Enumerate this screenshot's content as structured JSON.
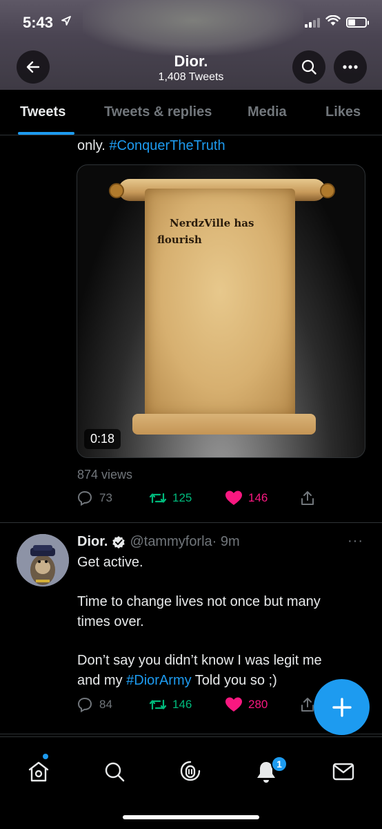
{
  "status_bar": {
    "time": "5:43"
  },
  "header": {
    "title": "Dior.",
    "subtitle": "1,408 Tweets"
  },
  "tabs": [
    {
      "label": "Tweets",
      "active": true
    },
    {
      "label": "Tweets & replies",
      "active": false
    },
    {
      "label": "Media",
      "active": false
    },
    {
      "label": "Likes",
      "active": false
    }
  ],
  "tweet1": {
    "text_prefix": "only. ",
    "hashtag": "#ConquerTheTruth",
    "media": {
      "scroll_line1": "NerdzVille has",
      "scroll_line2": "flourish",
      "duration": "0:18"
    },
    "views": "874 views",
    "replies": "73",
    "retweets": "125",
    "likes": "146"
  },
  "tweet2": {
    "name": "Dior.",
    "handle": "@tammyforla",
    "time": "· 9m",
    "line1": "Get active.",
    "line2": "Time to change lives not once but many",
    "line3": "times over.",
    "line4": "Don’t say you didn’t know I was legit me",
    "line5_prefix": "and my ",
    "line5_hashtag": "#DiorArmy",
    "line5_suffix": " Told you so ;)",
    "replies": "84",
    "retweets": "146",
    "likes": "280"
  },
  "bottom_nav": {
    "notification_count": "1"
  },
  "colors": {
    "accent": "#1d9bf0",
    "retweet": "#00ba7c",
    "like": "#f91880",
    "muted": "#71767b"
  }
}
